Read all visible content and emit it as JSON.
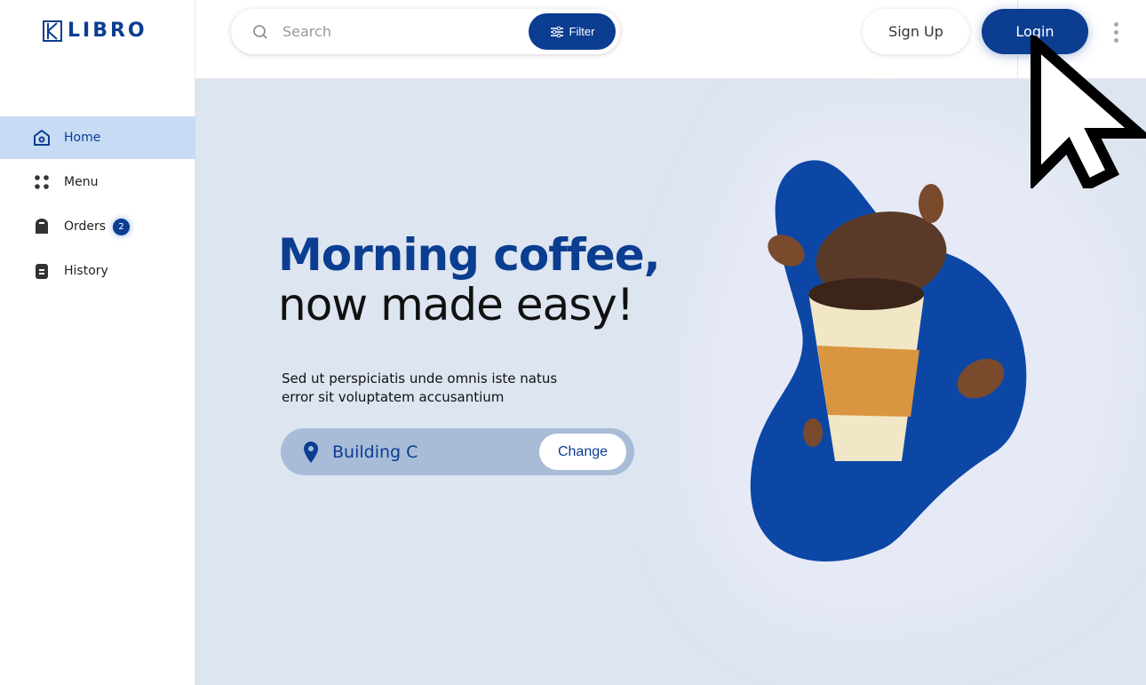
{
  "brand": {
    "name": "LIBRO",
    "color": "#0b3d91"
  },
  "sidebar": {
    "items": [
      {
        "label": "Home",
        "icon": "home-icon",
        "active": true
      },
      {
        "label": "Menu",
        "icon": "grid-dots-icon"
      },
      {
        "label": "Orders",
        "icon": "bag-icon",
        "badge": "2"
      },
      {
        "label": "History",
        "icon": "receipt-icon"
      }
    ]
  },
  "search": {
    "placeholder": "Search",
    "value": "",
    "filter_label": "Filter"
  },
  "auth": {
    "signup_label": "Sign Up",
    "login_label": "Login"
  },
  "hero": {
    "title_line1": "Morning coffee,",
    "title_line2": "now made easy!",
    "description": "Sed ut perspiciatis unde omnis iste natus error sit voluptatem accusantium",
    "location": "Building C",
    "change_label": "Change"
  }
}
